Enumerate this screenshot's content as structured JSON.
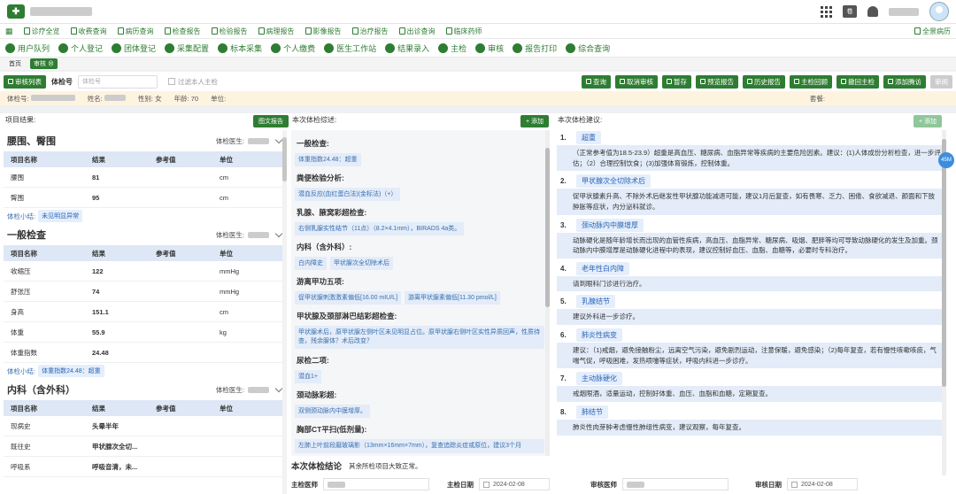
{
  "topbar": {
    "hospital_badge": "卷",
    "icons": [
      "grid-icon",
      "hospital-icon",
      "bell-icon",
      "avatar-icon"
    ]
  },
  "menu": {
    "items": [
      "诊疗全览",
      "收费查询",
      "病历查询",
      "检查报告",
      "检验报告",
      "病理报告",
      "影像报告",
      "治疗报告",
      "出诊查询",
      "临床药师"
    ],
    "fullscreen": "全景病历"
  },
  "functions": [
    "用户队列",
    "个人登记",
    "团体登记",
    "采集配置",
    "标本采集",
    "个人缴费",
    "医生工作站",
    "结果录入",
    "主检",
    "审核",
    "报告打印",
    "综合查询"
  ],
  "tabs": [
    "首页",
    "审核"
  ],
  "search": {
    "list_btn": "审核列表",
    "label": "体检号",
    "placeholder": "体检号",
    "checkbox": "过滤本人主检"
  },
  "actions": [
    "查询",
    "取消审核",
    "暂存",
    "预览报告",
    "历史报告",
    "主检回顾",
    "撤回主检",
    "添加腾访",
    "审阅"
  ],
  "patient": {
    "id_label": "体检号:",
    "name_label": "姓名:",
    "gender_label": "性别:",
    "gender": "女",
    "age_label": "年龄:",
    "age": "70",
    "unit_label": "单位:",
    "package_label": "套餐:"
  },
  "left": {
    "header": "项目结果:",
    "btn": "图文报告",
    "cols": [
      "项目名称",
      "结果",
      "参考值",
      "单位"
    ],
    "doctor_label": "体检医生:",
    "sections": [
      {
        "title": "腰围、臀围",
        "rows": [
          [
            "腰围",
            "81",
            "",
            "cm"
          ],
          [
            "臀围",
            "95",
            "",
            "cm"
          ]
        ],
        "summary_label": "体检小结:",
        "chips": [
          "未见明显异常"
        ]
      },
      {
        "title": "一般检查",
        "rows": [
          [
            "收缩压",
            "122",
            "",
            "mmHg"
          ],
          [
            "舒张压",
            "74",
            "",
            "mmHg"
          ],
          [
            "身高",
            "151.1",
            "",
            "cm"
          ],
          [
            "体重",
            "55.9",
            "",
            "kg"
          ],
          [
            "体重指数",
            "24.48",
            "",
            ""
          ]
        ],
        "summary_label": "体检小结:",
        "chips": [
          "体重指数24.48：超重"
        ]
      },
      {
        "title": "内科（含外科）",
        "rows": [
          [
            "现病史",
            "头晕半年",
            "",
            ""
          ],
          [
            "既往史",
            "甲状腺次全切...",
            "",
            ""
          ],
          [
            "呼吸系",
            "呼吸音清，未...",
            "",
            ""
          ]
        ],
        "summary_label": "",
        "chips": []
      }
    ]
  },
  "mid": {
    "header": "本次体检综述:",
    "add": "+ 添加",
    "items": [
      {
        "title": "一般检查:",
        "chips": [
          "体重指数24.48：超重"
        ]
      },
      {
        "title": "粪便检验分析:",
        "chips": [
          "潜血反应(血红蛋白法)(金标法)（+）"
        ]
      },
      {
        "title": "乳腺、腋窝彩超检查:",
        "chips": [
          "右侧乳腺实性结节（11点）（8.2×4.1mm），BIRADS 4a类。"
        ]
      },
      {
        "title": "内科（含外科）:",
        "chips": [
          "白内障史",
          "甲状腺次全切除术后"
        ]
      },
      {
        "title": "游离甲功五项:",
        "chips": [
          "促甲状腺刺激激素偏低[16.00 mIU/L]",
          "游离甲状腺素偏低[11.30 pmol/L]"
        ]
      },
      {
        "title": "甲状腺及颈部淋巴结彩超检查:",
        "block": "甲状腺术后，原甲状腺左侧叶区未见明显占位。原甲状腺右侧叶区实性异质回声，性质待查，残余腺体？术后改变？"
      },
      {
        "title": "尿检二项:",
        "chips": [
          "潜血1+"
        ]
      },
      {
        "title": "颈动脉彩超:",
        "chips": [
          "双侧颈动脉内中膜增厚。"
        ]
      },
      {
        "title": "胸部CT平扫(低剂量):",
        "block": "左肺上叶前段磨玻璃影（13mm×16mm×7mm），复查追踪炎症或原位，建议3个月"
      }
    ]
  },
  "right": {
    "header": "本次体检建议:",
    "add": "+ 添加",
    "items": [
      {
        "n": "1.",
        "title": "超重",
        "body": "（正常参考值为18.5-23.9）超重是高血压、糖尿病、血脂异常等疾病的主要危险因素。建议：(1)人体成份分析检查，进一步评估；（2）合理控制饮食；(3)加强体育锻炼，控制体重。"
      },
      {
        "n": "2.",
        "title": "甲状腺次全切除术后",
        "body": "促甲状腺素升高、不除外术后继发性甲状腺功能减退可能，建议1月后复查，如有畏寒、乏力、困倦、食欲减退、颜面和下肢肿胀等症状，内分泌科就诊。"
      },
      {
        "n": "3.",
        "title": "颈动脉内中膜增厚",
        "body": "动脉硬化是随年龄增长而出现的血管性疾病，高血压、血脂异常、糖尿病、吸烟、肥胖等均可导致动脉硬化的发生及加重。颈动脉内中膜增厚是动脉硬化进程中的表现，建议控制好血压、血脂、血糖等，必要时专科治疗。"
      },
      {
        "n": "4.",
        "title": "老年性白内障",
        "body": "请到眼科门诊进行治疗。"
      },
      {
        "n": "5.",
        "title": "乳腺结节",
        "body": "建议外科进一步诊疗。"
      },
      {
        "n": "6.",
        "title": "肺炎性病变",
        "body": "建议：（1)戒烟，避免接触粉尘，远离空气污染，避免剧烈运动，注意保暖，避免感染；（2)每年复查，若有慢性咳嗽咳痰，气喘气促，呼吸困难，发热喷嚏等症状，呼吸内科进一步诊疗。"
      },
      {
        "n": "7.",
        "title": "主动脉硬化",
        "body": "戒烟限酒，适量运动，控制好体重、血压、血脂和血糖，定期复查。"
      },
      {
        "n": "8.",
        "title": "肺结节",
        "body": "肺炎性肉芽肿考虑慢性肺组性病变，建议观察，每年复查。"
      }
    ]
  },
  "conclusion": {
    "title": "本次体检结论",
    "text": "其余所检项目大致正常。"
  },
  "footer": {
    "main_doctor": "主检医师",
    "main_date_label": "主检日期",
    "main_date": "2024-02-08",
    "review_doctor": "审核医师",
    "review_date_label": "审核日期",
    "review_date": "2024-02-08"
  },
  "float_badge": "45M"
}
